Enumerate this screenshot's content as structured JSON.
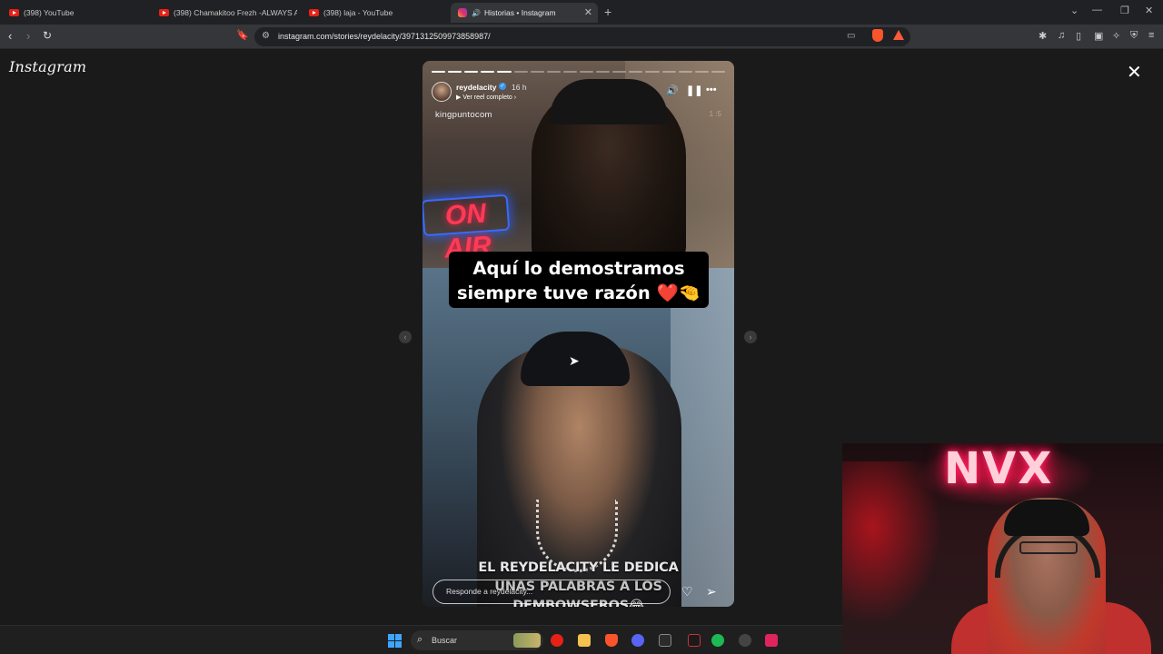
{
  "browser": {
    "tabs": [
      {
        "label": "(398) YouTube",
        "icon": "youtube-icon"
      },
      {
        "label": "(398) Chamakitoo Frezh -ALWAYS AL",
        "icon": "youtube-icon"
      },
      {
        "label": "(398) laja - YouTube",
        "icon": "youtube-icon"
      },
      {
        "label": "Historias • Instagram",
        "icon": "instagram-icon",
        "active": true
      }
    ],
    "url": "instagram.com/stories/reydelacity/3971312509973858987/"
  },
  "page": {
    "logo": "Instagram",
    "close_glyph": "✕"
  },
  "story": {
    "username": "reydelacity",
    "time": "16 h",
    "reel_link": "Ver reel completo",
    "watermark": "kingpuntocom",
    "watermark_right": "1 :5",
    "caption_line1": "Aquí lo demostramos",
    "caption_line2": "siempre tuve razón ❤️🤏",
    "onair_sign": "ON AIR",
    "subtitle_line1": "EL REYDELACITY LE DEDICA",
    "subtitle_line2": "UNAS PALABRAS A LOS",
    "subtitle_line3": "DEMBOWSEROS😂",
    "reply_placeholder": "Responde a reydelacity...",
    "progress_total": 18,
    "progress_done": 5
  },
  "webcam": {
    "neon_sign": "NVX"
  },
  "taskbar": {
    "search_label": "Buscar"
  },
  "colors": {
    "instagram_verified": "#3897f0",
    "youtube_red": "#e62117",
    "neon_pink": "#ff2060"
  }
}
